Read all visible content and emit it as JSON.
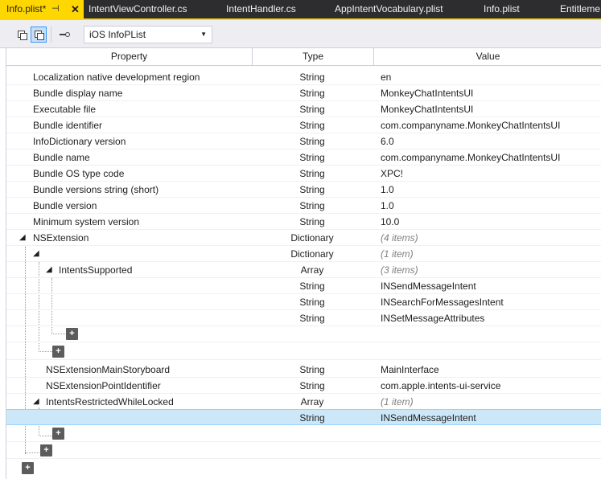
{
  "tabs": {
    "t0": {
      "label": "Info.plist*",
      "pin": "⊣",
      "close": "✕"
    },
    "t1": {
      "label": "IntentViewController.cs"
    },
    "t2": {
      "label": "IntentHandler.cs"
    },
    "t3": {
      "label": "AppIntentVocabulary.plist"
    },
    "t4": {
      "label": "Info.plist"
    },
    "t5": {
      "label": "Entitleme"
    }
  },
  "toolbar": {
    "select_value": "iOS InfoPList",
    "chevron": "▼"
  },
  "header": {
    "property": "Property",
    "type": "Type",
    "value": "Value"
  },
  "rows": {
    "r0": {
      "prop": "Localization native development region",
      "type": "String",
      "value": "en"
    },
    "r1": {
      "prop": "Bundle display name",
      "type": "String",
      "value": "MonkeyChatIntentsUI"
    },
    "r2": {
      "prop": "Executable file",
      "type": "String",
      "value": "MonkeyChatIntentsUI"
    },
    "r3": {
      "prop": "Bundle identifier",
      "type": "String",
      "value": "com.companyname.MonkeyChatIntentsUI"
    },
    "r4": {
      "prop": "InfoDictionary version",
      "type": "String",
      "value": "6.0"
    },
    "r5": {
      "prop": "Bundle name",
      "type": "String",
      "value": "com.companyname.MonkeyChatIntentsUI"
    },
    "r6": {
      "prop": "Bundle OS type code",
      "type": "String",
      "value": "XPC!"
    },
    "r7": {
      "prop": "Bundle versions string (short)",
      "type": "String",
      "value": "1.0"
    },
    "r8": {
      "prop": "Bundle version",
      "type": "String",
      "value": "1.0"
    },
    "r9": {
      "prop": "Minimum system version",
      "type": "String",
      "value": "10.0"
    },
    "r10": {
      "prop": "NSExtension",
      "type": "Dictionary",
      "value": "(4 items)"
    },
    "r11": {
      "prop": "",
      "type": "Dictionary",
      "value": "(1 item)"
    },
    "r12": {
      "prop": "IntentsSupported",
      "type": "Array",
      "value": "(3 items)"
    },
    "r13": {
      "prop": "",
      "type": "String",
      "value": "INSendMessageIntent"
    },
    "r14": {
      "prop": "",
      "type": "String",
      "value": "INSearchForMessagesIntent"
    },
    "r15": {
      "prop": "",
      "type": "String",
      "value": "INSetMessageAttributes"
    },
    "r16": {
      "prop": "NSExtensionMainStoryboard",
      "type": "String",
      "value": "MainInterface"
    },
    "r17": {
      "prop": "NSExtensionPointIdentifier",
      "type": "String",
      "value": "com.apple.intents-ui-service"
    },
    "r18": {
      "prop": "IntentsRestrictedWhileLocked",
      "type": "Array",
      "value": "(1 item)"
    },
    "r19": {
      "prop": "",
      "type": "String",
      "value": "INSendMessageIntent"
    }
  },
  "icons": {
    "expand": "◢",
    "add": "+"
  }
}
